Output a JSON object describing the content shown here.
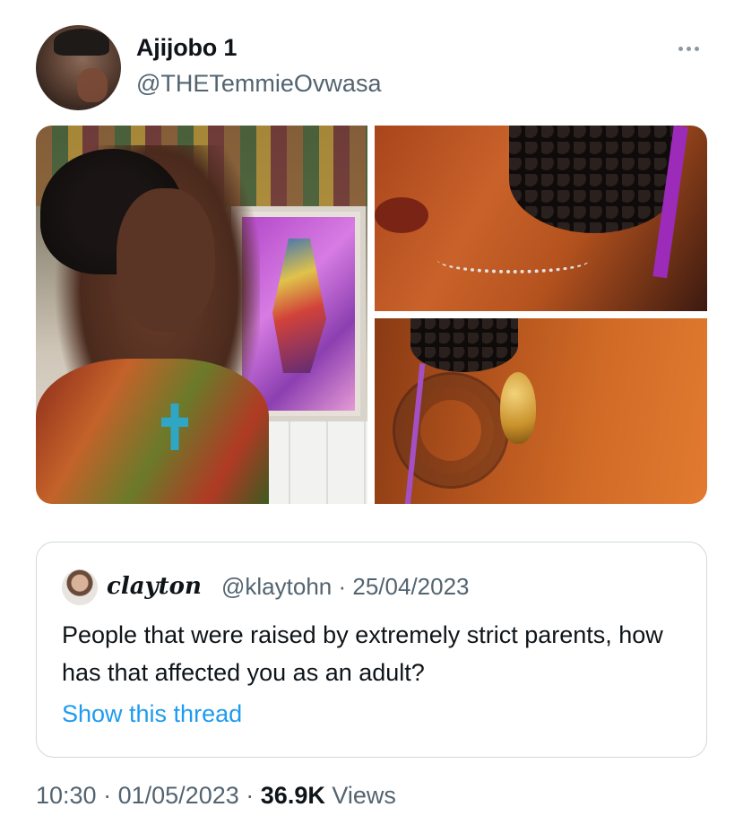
{
  "author": {
    "display_name": "Ajijobo 1",
    "handle": "@THETemmieOvwasa"
  },
  "quoted_tweet": {
    "display_name": "clayton",
    "handle": "@klaytohn",
    "separator": "·",
    "date": "25/04/2023",
    "text": "People that were raised by extremely strict parents, how has that affected you as an adult?",
    "show_thread": "Show this thread"
  },
  "footer": {
    "time": "10:30",
    "separator1": "·",
    "date": "01/05/2023",
    "separator2": "·",
    "views_count": "36.9K",
    "views_label": "Views"
  },
  "icons": {
    "more": "more-dots-icon"
  },
  "colors": {
    "link": "#1d9bf0",
    "secondary_text": "#536471",
    "primary_text": "#0f1419",
    "border": "#cfd9de"
  }
}
